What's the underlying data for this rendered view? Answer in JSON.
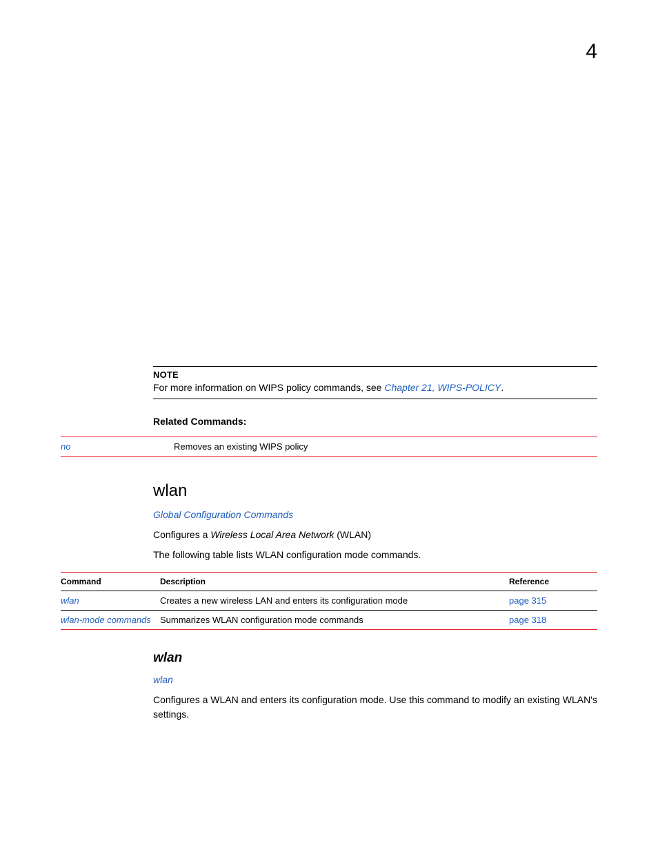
{
  "page_number": "4",
  "note": {
    "title": "NOTE",
    "text_prefix": "For more information on WIPS policy commands, see ",
    "link": "Chapter 21, WIPS-POLICY",
    "text_suffix": "."
  },
  "related_commands": {
    "heading": "Related Commands:",
    "rows": [
      {
        "cmd": "no",
        "desc": "Removes an existing WIPS policy"
      }
    ]
  },
  "section_wlan": {
    "heading": "wlan",
    "subhead_link": "Global Configuration Commands",
    "desc1_prefix": "Configures a ",
    "desc1_italic": "Wireless Local Area Network",
    "desc1_suffix": " (WLAN)",
    "desc2": "The following table lists WLAN configuration mode commands."
  },
  "wlan_table": {
    "headers": {
      "command": "Command",
      "description": "Description",
      "reference": "Reference"
    },
    "rows": [
      {
        "cmd": "wlan",
        "desc": "Creates a new wireless LAN and enters its configuration mode",
        "ref": "page 315"
      },
      {
        "cmd": "wlan-mode commands",
        "desc": "Summarizes WLAN configuration mode commands",
        "ref": "page 318"
      }
    ]
  },
  "subsection_wlan": {
    "heading": "wlan",
    "parent_link": "wlan",
    "desc": "Configures a WLAN and enters its configuration mode. Use this command to modify an existing WLAN's settings."
  }
}
